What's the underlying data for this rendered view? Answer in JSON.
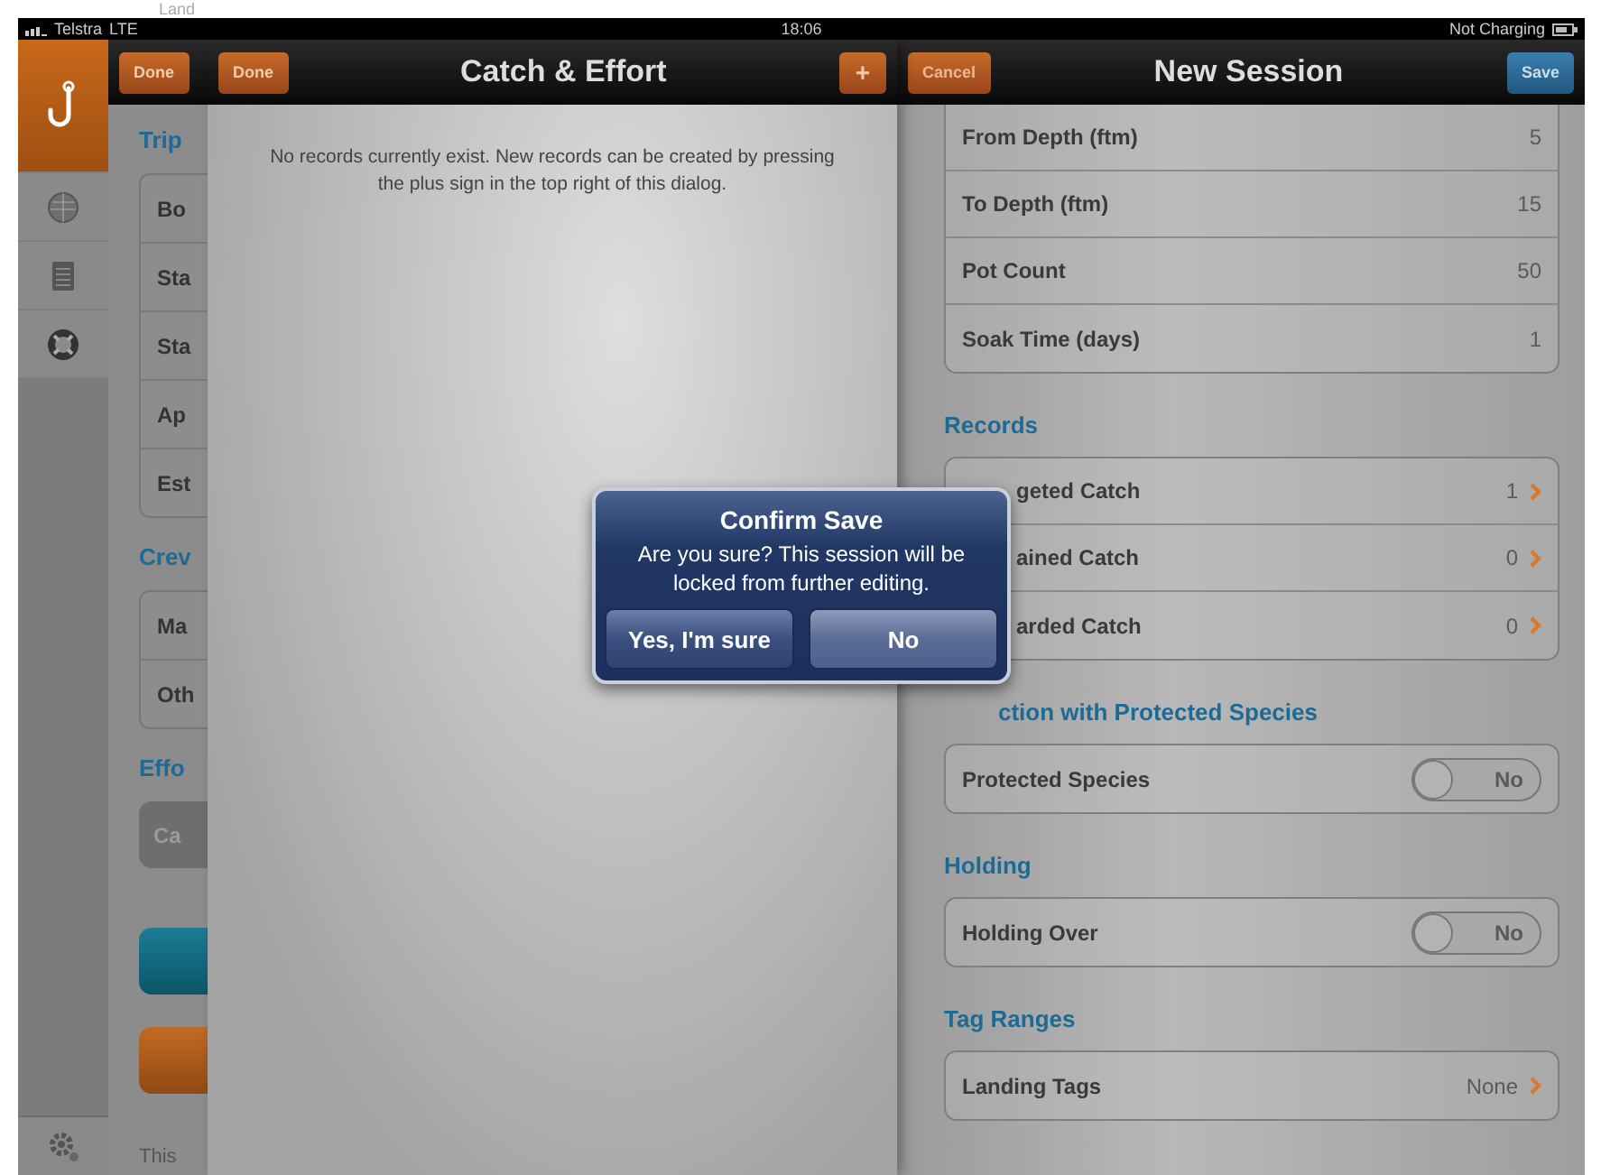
{
  "top_strip": {
    "text": "Land"
  },
  "status_bar": {
    "carrier": "Telstra",
    "network": "LTE",
    "time": "18:06",
    "battery_status": "Not Charging"
  },
  "sidebar": {
    "items": [
      {
        "kind": "hook",
        "selected": true
      },
      {
        "kind": "radar",
        "selected": false
      },
      {
        "kind": "notepad",
        "selected": false
      },
      {
        "kind": "lifebuoy",
        "selected": false
      }
    ],
    "footer": {
      "kind": "gear"
    }
  },
  "left_panel": {
    "nav_button": "Done",
    "sections": [
      {
        "header": "Trip",
        "rows": [
          "Bo",
          "Sta",
          "Sta",
          "Ap",
          "Est"
        ]
      },
      {
        "header": "Crev",
        "rows": [
          "Ma",
          "Oth"
        ]
      },
      {
        "header": "Effo",
        "buttons": [
          {
            "kind": "grey",
            "label": "Ca"
          },
          {
            "kind": "teal"
          },
          {
            "kind": "orange"
          }
        ]
      }
    ],
    "footer_text": "This"
  },
  "catch_panel": {
    "nav_button": "Done",
    "title": "Catch & Effort",
    "add_button": "+",
    "message": "No records currently exist. New records can be created by pressing the plus sign in the top right of this dialog."
  },
  "session_panel": {
    "cancel_button": "Cancel",
    "title": "New Session",
    "save_button": "Save",
    "sections": [
      {
        "rows": [
          {
            "kind": "value",
            "label": "From Depth (ftm)",
            "value": "5"
          },
          {
            "kind": "value",
            "label": "To Depth (ftm)",
            "value": "15"
          },
          {
            "kind": "value",
            "label": "Pot Count",
            "value": "50"
          },
          {
            "kind": "value",
            "label": "Soak Time (days)",
            "value": "1"
          }
        ]
      },
      {
        "header": "Records",
        "rows": [
          {
            "kind": "link",
            "label": "geted Catch",
            "value": "1"
          },
          {
            "kind": "link",
            "label": "ained Catch",
            "value": "0"
          },
          {
            "kind": "link",
            "label": "arded Catch",
            "value": "0"
          }
        ]
      },
      {
        "header": "ction with Protected Species",
        "rows": [
          {
            "kind": "toggle",
            "label": "Protected Species",
            "on": false,
            "toggle_text": "No"
          }
        ]
      },
      {
        "header": "Holding",
        "rows": [
          {
            "kind": "toggle",
            "label": "Holding Over",
            "on": false,
            "toggle_text": "No"
          }
        ]
      },
      {
        "header": "Tag Ranges",
        "rows": [
          {
            "kind": "link",
            "label": "Landing Tags",
            "value": "None"
          }
        ]
      }
    ]
  },
  "dialog": {
    "title": "Confirm Save",
    "message": "Are you sure? This session will be locked from further editing.",
    "buttons": [
      "Yes, I'm sure",
      "No"
    ]
  }
}
